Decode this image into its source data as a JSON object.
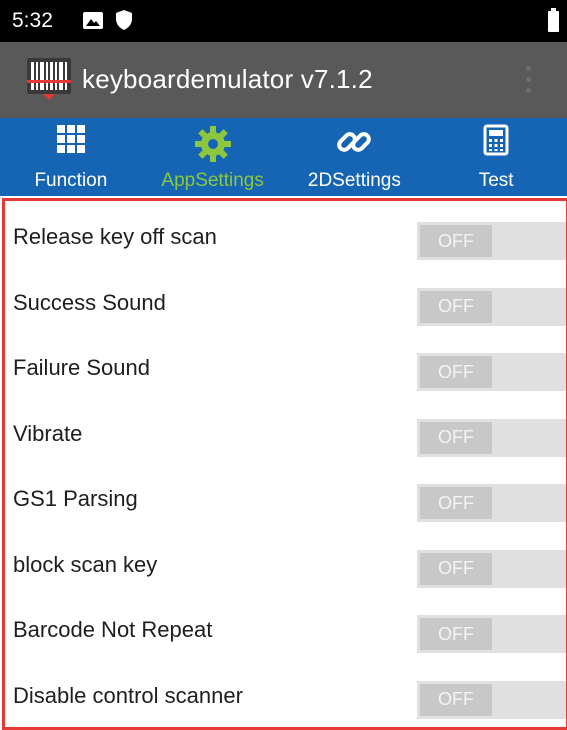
{
  "status_bar": {
    "time": "5:32"
  },
  "app_bar": {
    "title": "keyboardemulator v7.1.2"
  },
  "tabs": [
    {
      "label": "Function",
      "icon": "grid-icon",
      "active": false
    },
    {
      "label": "AppSettings",
      "icon": "gear-icon",
      "active": true
    },
    {
      "label": "2DSettings",
      "icon": "link-icon",
      "active": false
    },
    {
      "label": "Test",
      "icon": "calculator-icon",
      "active": false
    }
  ],
  "settings": [
    {
      "label": "Release key off scan",
      "state": "OFF"
    },
    {
      "label": "Success Sound",
      "state": "OFF"
    },
    {
      "label": "Failure Sound",
      "state": "OFF"
    },
    {
      "label": "Vibrate",
      "state": "OFF"
    },
    {
      "label": "GS1 Parsing",
      "state": "OFF"
    },
    {
      "label": "block scan key",
      "state": "OFF"
    },
    {
      "label": "Barcode Not Repeat",
      "state": "OFF"
    },
    {
      "label": "Disable control scanner",
      "state": "OFF"
    }
  ],
  "colors": {
    "status_bar": "#000000",
    "app_bar": "#595959",
    "tab_bar": "#1565b4",
    "active_tab": "#8dc63f",
    "highlight_border": "#e53935"
  }
}
